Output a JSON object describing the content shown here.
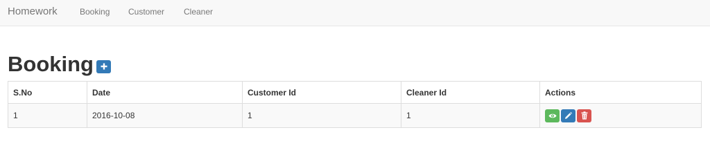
{
  "navbar": {
    "brand": "Homework",
    "links": [
      {
        "label": "Booking"
      },
      {
        "label": "Customer"
      },
      {
        "label": "Cleaner"
      }
    ]
  },
  "page": {
    "title": "Booking",
    "add_icon": "plus-icon"
  },
  "table": {
    "columns": [
      "S.No",
      "Date",
      "Customer Id",
      "Cleaner Id",
      "Actions"
    ],
    "rows": [
      {
        "sno": "1",
        "date": "2016-10-08",
        "customer_id": "1",
        "cleaner_id": "1"
      }
    ],
    "action_icons": [
      "eye-icon",
      "pencil-icon",
      "trash-icon"
    ]
  },
  "colors": {
    "primary": "#337ab7",
    "success": "#5cb85c",
    "danger": "#d9534f",
    "navbar_bg": "#f8f8f8"
  }
}
